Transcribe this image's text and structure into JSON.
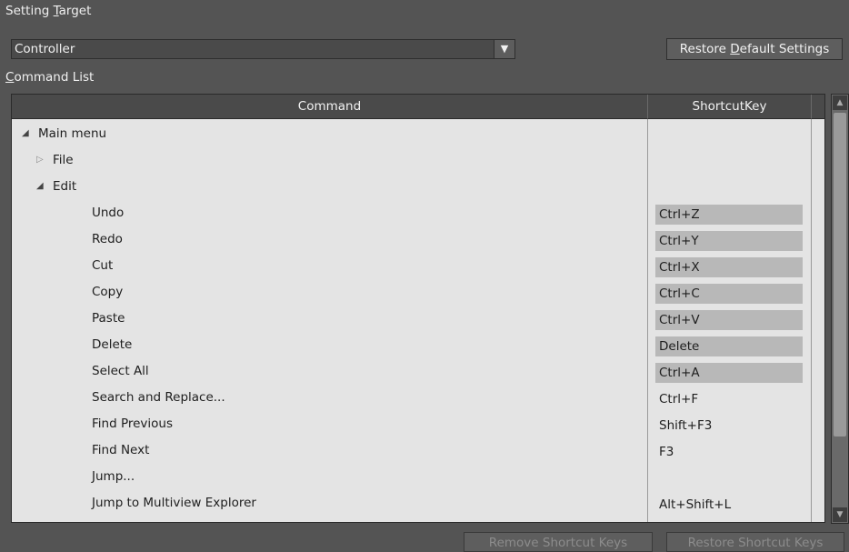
{
  "setting_target": {
    "label_pre": "Setting ",
    "label_u": "T",
    "label_post": "arget",
    "value": "Controller"
  },
  "restore_default": {
    "pre": "Restore ",
    "u": "D",
    "post": "efault Settings"
  },
  "command_list": {
    "label_u": "C",
    "label_post": "ommand List"
  },
  "grid": {
    "col_command": "Command",
    "col_shortcut": "ShortcutKey",
    "rows": [
      {
        "command": "Main menu",
        "key": "",
        "level": 0,
        "tree": "expanded"
      },
      {
        "command": "File",
        "key": "",
        "level": 1,
        "tree": "collapsed"
      },
      {
        "command": "Edit",
        "key": "",
        "level": 1,
        "tree": "expanded"
      },
      {
        "command": "Undo",
        "key": "Ctrl+Z",
        "level": 2,
        "shaded": true
      },
      {
        "command": "Redo",
        "key": "Ctrl+Y",
        "level": 2,
        "shaded": true
      },
      {
        "command": "Cut",
        "key": "Ctrl+X",
        "level": 2,
        "shaded": true
      },
      {
        "command": "Copy",
        "key": "Ctrl+C",
        "level": 2,
        "shaded": true
      },
      {
        "command": "Paste",
        "key": "Ctrl+V",
        "level": 2,
        "shaded": true
      },
      {
        "command": "Delete",
        "key": "Delete",
        "level": 2,
        "shaded": true
      },
      {
        "command": "Select All",
        "key": "Ctrl+A",
        "level": 2,
        "shaded": true
      },
      {
        "command": "Search and Replace...",
        "key": "Ctrl+F",
        "level": 2,
        "shaded": false
      },
      {
        "command": "Find Previous",
        "key": "Shift+F3",
        "level": 2,
        "shaded": false
      },
      {
        "command": "Find Next",
        "key": "F3",
        "level": 2,
        "shaded": false
      },
      {
        "command": "Jump...",
        "key": "",
        "level": 2,
        "shaded": false
      },
      {
        "command": "Jump to Multiview Explorer",
        "key": "Alt+Shift+L",
        "level": 2,
        "shaded": false
      }
    ]
  },
  "buttons": {
    "remove": "Remove Shortcut Keys",
    "restore_keys": "Restore Shortcut Keys"
  },
  "icons": {
    "dropdown": "dropdown-arrow-icon",
    "expanded": "tree-expanded-icon",
    "collapsed": "tree-collapsed-icon"
  }
}
